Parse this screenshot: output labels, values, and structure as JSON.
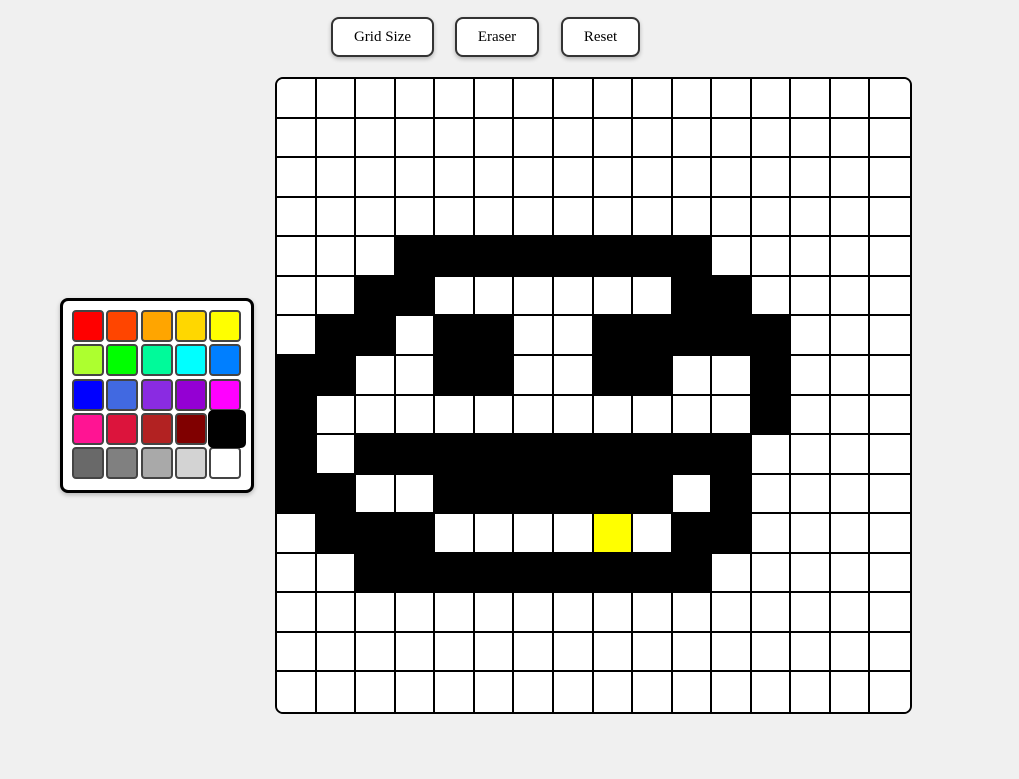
{
  "toolbar": {
    "grid_size_label": "Grid Size",
    "eraser_label": "Eraser",
    "reset_label": "Reset"
  },
  "palette": {
    "colors": [
      "#ff0000",
      "#ff4500",
      "#ffa500",
      "#ffd700",
      "#ffff00",
      "#adff2f",
      "#00ff00",
      "#00fa9a",
      "#00ffff",
      "#007fff",
      "#0000ff",
      "#4169e1",
      "#8a2be2",
      "#9400d3",
      "#ff00ff",
      "#ff1493",
      "#dc143c",
      "#b22222",
      "#800000",
      "#000000",
      "#696969",
      "#808080",
      "#a9a9a9",
      "#d3d3d3",
      "#ffffff"
    ],
    "selected_index": 19
  },
  "canvas": {
    "grid_size": 16,
    "legend": {
      ".": "#ffffff",
      "#": "#000000",
      "Y": "#ffff00"
    },
    "rows": [
      "................",
      "................",
      "................",
      "................",
      "...########.....",
      "..##......##....",
      ".##.##..#####...",
      "##..##..##..#...",
      "#...........#...",
      "#.##########....",
      "##..######.#....",
      ".###....Y.##....",
      "..#########.....",
      "................",
      "................",
      "................"
    ]
  }
}
